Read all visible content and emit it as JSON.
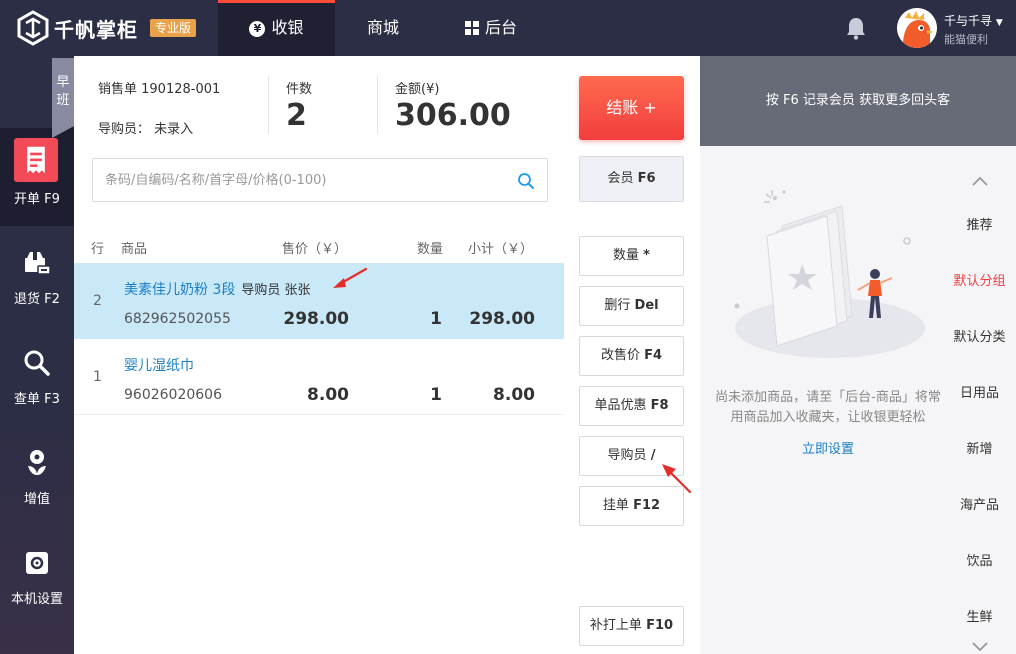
{
  "topbar": {
    "brand": "千帆掌柜",
    "edition": "专业版",
    "tabs": [
      {
        "label": "收银",
        "icon": "yen-circle-icon",
        "active": true
      },
      {
        "label": "商城",
        "active": false
      },
      {
        "label": "后台",
        "icon": "grid-icon",
        "active": false
      }
    ],
    "user": {
      "name": "千与千寻",
      "shop": "能猫便利"
    }
  },
  "shift": {
    "label": "早班"
  },
  "leftnav": [
    {
      "label": "开单 F9",
      "icon": "receipt-icon",
      "active": true
    },
    {
      "label": "退货 F2",
      "icon": "return-box-icon",
      "active": false
    },
    {
      "label": "查单 F3",
      "icon": "search-icon",
      "active": false
    },
    {
      "label": "增值",
      "icon": "sprout-icon",
      "active": false
    },
    {
      "label": "本机设置",
      "icon": "gear-icon",
      "active": false
    }
  ],
  "order": {
    "sale_no": "销售单 190128-001",
    "guide": "导购员： 未录入",
    "count_label": "件数",
    "count": "2",
    "amount_label": "金额(¥)",
    "amount": "306.00"
  },
  "search": {
    "placeholder": "条码/自编码/名称/首字母/价格(0-100)"
  },
  "table": {
    "headers": {
      "row": "行",
      "product": "商品",
      "price": "售价（￥）",
      "qty": "数量",
      "subtotal": "小计（￥）"
    },
    "rows": [
      {
        "no": "2",
        "name": "美素佳儿奶粉 3段",
        "guide": "导购员 张张",
        "code": "682962502055",
        "price": "298.00",
        "qty": "1",
        "subtotal": "298.00",
        "selected": true
      },
      {
        "no": "1",
        "name": "婴儿湿纸巾",
        "guide": "",
        "code": "96026020606",
        "price": "8.00",
        "qty": "1",
        "subtotal": "8.00",
        "selected": false
      }
    ]
  },
  "buttons": {
    "checkout": "结账 +",
    "member": {
      "text": "会员",
      "key": "F6"
    },
    "qty": {
      "text": "数量",
      "key": "*"
    },
    "delete_row": {
      "text": "删行",
      "key": "Del"
    },
    "change_price": {
      "text": "改售价",
      "key": "F4"
    },
    "discount": {
      "text": "单品优惠",
      "key": "F8"
    },
    "guide": {
      "text": "导购员",
      "key": "/"
    },
    "hold": {
      "text": "挂单",
      "key": "F12"
    },
    "reprint": {
      "text": "补打上单",
      "key": "F10"
    }
  },
  "right": {
    "banner": "按 F6 记录会员 获取更多回头客",
    "empty_text": "尚未添加商品，请至「后台-商品」将常用商品加入收藏夹，让收银更轻松",
    "setup_link": "立即设置",
    "categories": [
      {
        "label": "推荐",
        "active": false
      },
      {
        "label": "默认分组",
        "active": true
      },
      {
        "label": "默认分类",
        "active": false
      },
      {
        "label": "日用品",
        "active": false
      },
      {
        "label": "新增",
        "active": false
      },
      {
        "label": "海产品",
        "active": false
      },
      {
        "label": "饮品",
        "active": false
      },
      {
        "label": "生鲜",
        "active": false
      }
    ]
  },
  "colors": {
    "topbar": "#2c2e45",
    "accent": "#f03e3e",
    "selected_row": "#c9e8f8",
    "link": "#1b7fc8"
  }
}
